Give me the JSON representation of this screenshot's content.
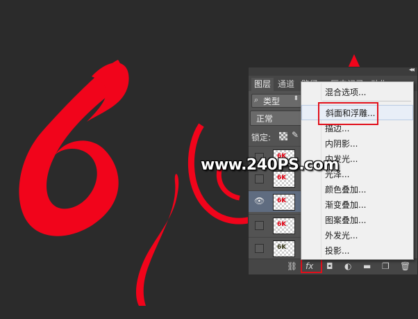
{
  "canvas": {
    "background": "#2b2b2b",
    "artwork_color": "#f1041b",
    "artwork_icon": "stylized-6-logo"
  },
  "panel": {
    "collapse_icon": "double-chevron-icon",
    "tabs": [
      "图层",
      "通道",
      "路径",
      "历史记录",
      "动作"
    ],
    "filter_label": "类型",
    "blend_mode": "正常",
    "lock_label": "锁定:",
    "layers": [
      {
        "thumb_text": "6K",
        "visible": false
      },
      {
        "thumb_text": "6K",
        "visible": false
      },
      {
        "thumb_text": "6K",
        "visible": true,
        "selected": true
      },
      {
        "thumb_text": "6K",
        "visible": false
      },
      {
        "thumb_text": "6K",
        "visible": false
      }
    ],
    "bottom_icons": [
      "link-icon",
      "fx-icon",
      "mask-icon",
      "adjustment-icon",
      "group-icon",
      "new-layer-icon",
      "trash-icon"
    ]
  },
  "menu": {
    "items": [
      "混合选项...",
      "斜面和浮雕...",
      "描边...",
      "内阴影...",
      "内发光...",
      "光泽...",
      "颜色叠加...",
      "渐变叠加...",
      "图案叠加...",
      "外发光...",
      "投影..."
    ],
    "highlighted_index": 1
  },
  "watermark": "www.240PS.com",
  "accent_color": "#e10e1a"
}
